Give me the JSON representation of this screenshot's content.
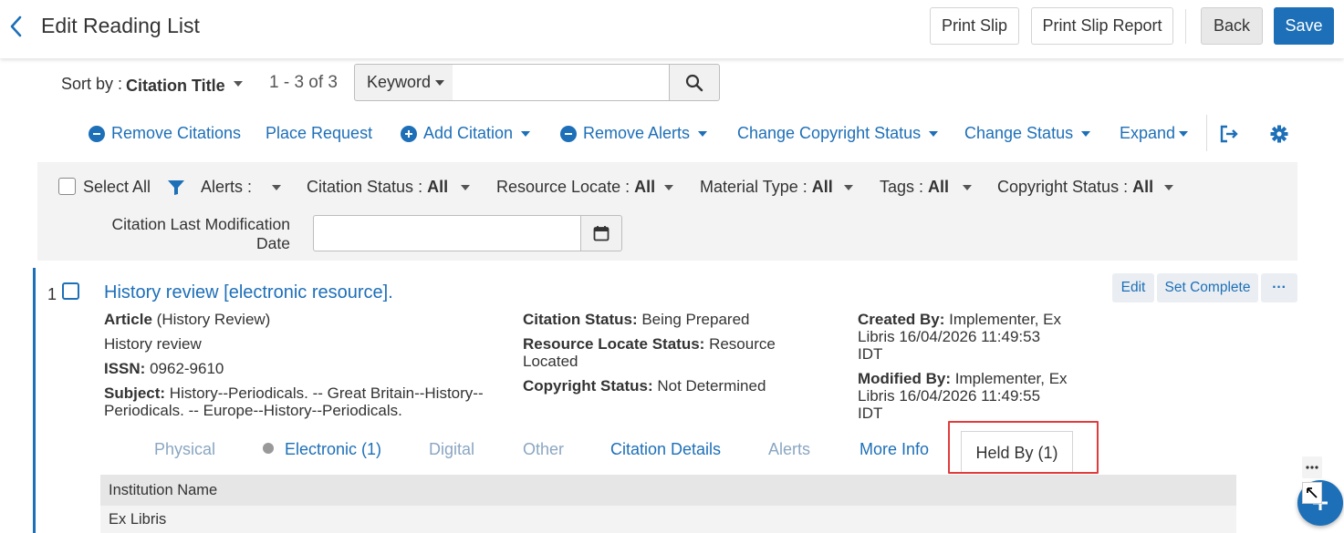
{
  "header": {
    "title": "Edit Reading List",
    "print_slip": "Print Slip",
    "print_slip_report": "Print Slip Report",
    "back": "Back",
    "save": "Save"
  },
  "sort": {
    "label": "Sort by :",
    "value": "Citation Title",
    "count": "1 - 3 of 3"
  },
  "search": {
    "scope": "Keyword",
    "query": "",
    "placeholder": ""
  },
  "toolbar": {
    "remove_citations": "Remove Citations",
    "place_request": "Place Request",
    "add_citation": "Add Citation",
    "remove_alerts": "Remove Alerts",
    "change_copyright_status": "Change Copyright Status",
    "change_status": "Change Status",
    "expand": "Expand"
  },
  "filters": {
    "select_all": "Select All",
    "alerts": "Alerts :",
    "citation_status": {
      "label": "Citation Status :",
      "value": "All"
    },
    "resource_locate": {
      "label": "Resource Locate :",
      "value": "All"
    },
    "material_type": {
      "label": "Material Type :",
      "value": "All"
    },
    "tags": {
      "label": "Tags :",
      "value": "All"
    },
    "copyright_status": {
      "label": "Copyright Status :",
      "value": "All"
    },
    "last_mod_label_1": "Citation Last Modification",
    "last_mod_label_2": "Date",
    "last_mod_value": ""
  },
  "record": {
    "number": "1",
    "title": "History review [electronic resource].",
    "type_label": "Article",
    "type_detail": "(History Review)",
    "subtitle": "History review",
    "issn_label": "ISSN:",
    "issn": "0962-9610",
    "subject_label": "Subject:",
    "subject_line1": "History--Periodicals. -- Great Britain--History--",
    "subject_line2": "Periodicals. -- Europe--History--Periodicals.",
    "citation_status_label": "Citation Status:",
    "citation_status": "Being Prepared",
    "resource_locate_label": "Resource Locate Status:",
    "resource_locate_1": "Resource",
    "resource_locate_2": "Located",
    "copyright_label": "Copyright Status:",
    "copyright": "Not Determined",
    "created_label": "Created By:",
    "created_1": "Implementer, Ex",
    "created_2": "Libris 16/04/2026 11:49:53",
    "created_3": "IDT",
    "modified_label": "Modified By:",
    "modified_1": "Implementer, Ex",
    "modified_2": "Libris 16/04/2026 11:49:55",
    "modified_3": "IDT",
    "edit": "Edit",
    "set_complete": "Set Complete",
    "more": "···"
  },
  "tabs": {
    "physical": "Physical",
    "electronic": "Electronic (1)",
    "digital": "Digital",
    "other": "Other",
    "citation_details": "Citation Details",
    "alerts": "Alerts",
    "more_info": "More Info",
    "held_by": "Held By (1)"
  },
  "table": {
    "header": "Institution Name",
    "rows": [
      "Ex Libris"
    ]
  },
  "colors": {
    "accent": "#1d6fb8",
    "highlight": "#e03c3c"
  }
}
